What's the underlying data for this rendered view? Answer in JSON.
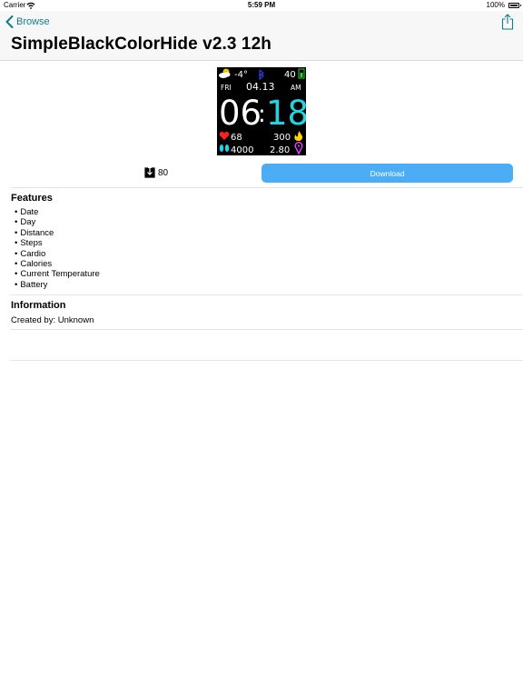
{
  "status_bar": {
    "carrier": "Carrier",
    "time": "5:59 PM",
    "battery_percent": "100%"
  },
  "nav": {
    "back_label": "Browse",
    "title": "SimpleBlackColorHide v2.3 12h"
  },
  "watchface": {
    "temperature": "-4°",
    "battery_level": "40",
    "day": "FRI",
    "date": "04.13",
    "period": "AM",
    "hour": "06",
    "minute": "18",
    "heart_rate": "68",
    "calories": "300",
    "steps": "4000",
    "distance": "2.80",
    "colors": {
      "background": "#000000",
      "minute": "#21d4e0",
      "heart": "#ff2020",
      "flame": "#ffd400",
      "steps_icon": "#21d4e0",
      "distance_icon": "#e040ff",
      "bluetooth": "#2a3bd9",
      "battery": "#2fd02f"
    }
  },
  "stats": {
    "download_count": "80",
    "download_button": "Download",
    "accent_color": "#4badf5"
  },
  "features": {
    "heading": "Features",
    "items": [
      "Date",
      "Day",
      "Distance",
      "Steps",
      "Cardio",
      "Calories",
      "Current Temperature",
      "Battery"
    ]
  },
  "information": {
    "heading": "Information",
    "created_by": "Created by: Unknown"
  }
}
